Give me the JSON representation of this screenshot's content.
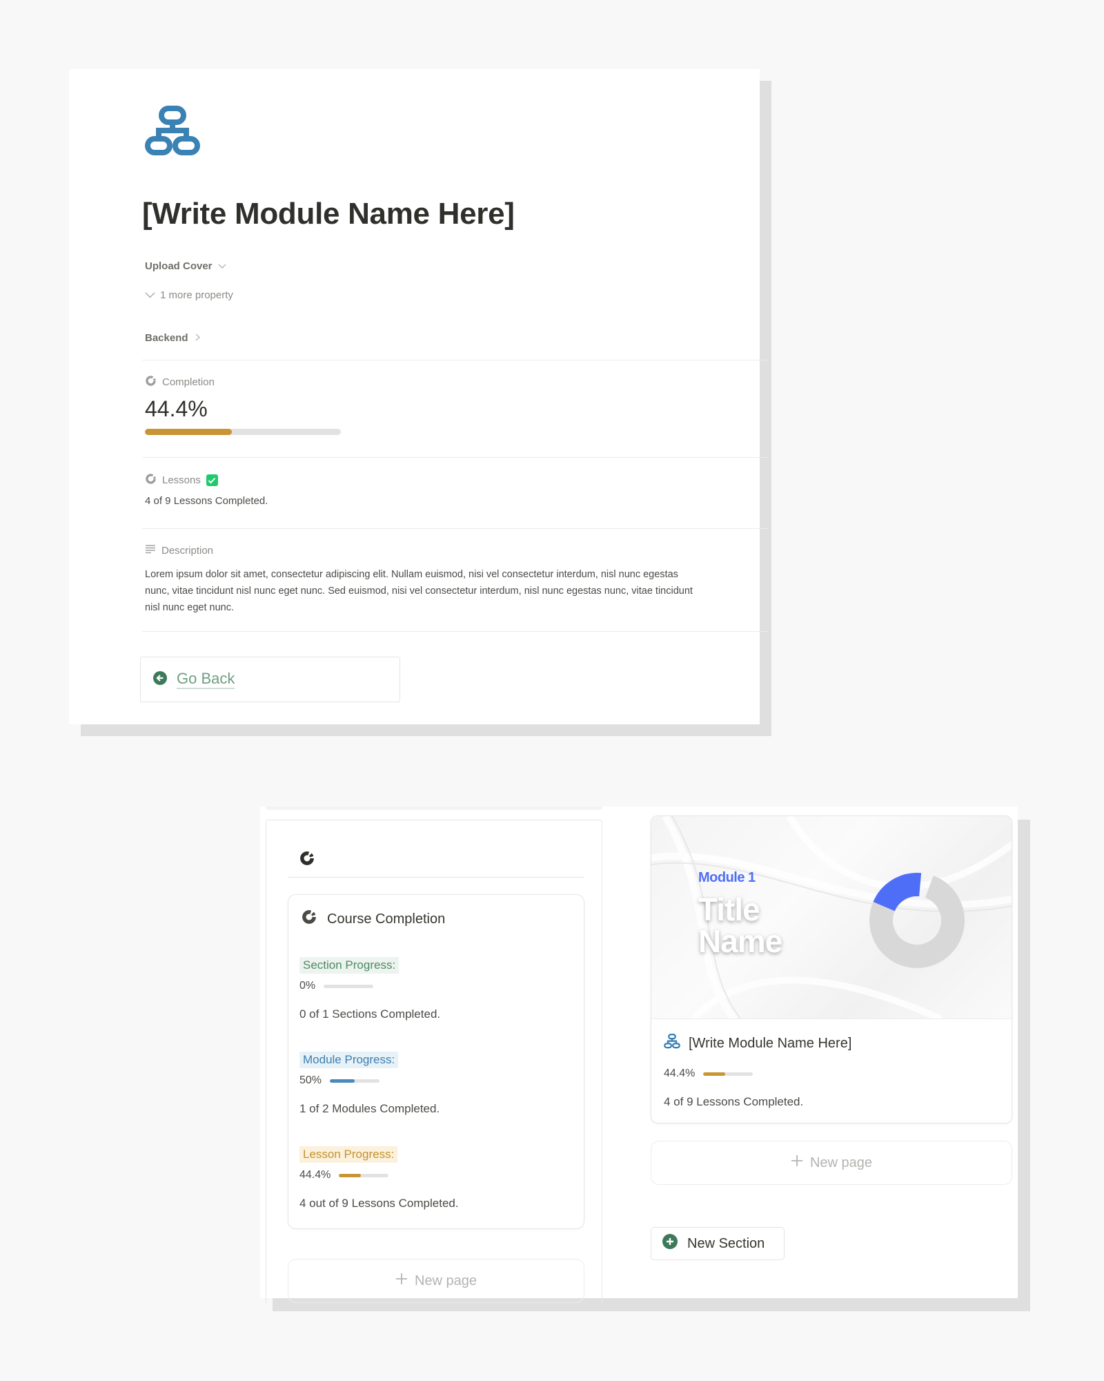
{
  "module_page": {
    "icon": "hierarchy-icon",
    "title": "[Write Module Name Here]",
    "upload_cover_label": "Upload Cover",
    "more_property_label": "1 more property",
    "backend_label": "Backend",
    "completion": {
      "label": "Completion",
      "icon": "progress-ring-icon",
      "value_text": "44.4%",
      "progress": 0.444,
      "color": "#c99433"
    },
    "lessons": {
      "label": "Lessons",
      "icon": "progress-ring-icon",
      "checked": true,
      "text": "4 of 9 Lessons Completed."
    },
    "description": {
      "label": "Description",
      "icon": "text-lines-icon",
      "text": "Lorem ipsum dolor sit amet, consectetur adipiscing elit. Nullam euismod, nisi vel consectetur interdum, nisl nunc egestas nunc, vitae tincidunt nisl nunc eget nunc. Sed euismod, nisi vel consectetur interdum, nisl nunc egestas nunc, vitae tincidunt nisl nunc eget nunc."
    },
    "go_back_label": "Go Back",
    "go_back_icon": "arrow-left-circle-icon"
  },
  "dashboard": {
    "column_icon": "progress-ring-icon",
    "course_completion": {
      "title": "Course Completion",
      "section": {
        "label": "Section Progress:",
        "value_text": "0%",
        "progress": 0,
        "count_text": "0 of 1 Sections Completed.",
        "color": "#4d8a62"
      },
      "module": {
        "label": "Module Progress:",
        "value_text": "50%",
        "progress": 0.5,
        "count_text": "1 of 2 Modules Completed.",
        "color": "#4a89b9"
      },
      "lesson": {
        "label": "Lesson Progress:",
        "value_text": "44.4%",
        "progress": 0.444,
        "count_text": "4 out of 9 Lessons Completed.",
        "color": "#c99433"
      }
    },
    "new_page_label": "New page",
    "module_card": {
      "cover_eyebrow": "Module 1",
      "cover_title_line1": "Title",
      "cover_title_line2": "Name",
      "cover_donut_progress": 0.2,
      "cover_donut_color": "#4f6ef7",
      "title": "[Write Module Name Here]",
      "value_text": "44.4%",
      "progress": 0.444,
      "count_text": "4 of 9 Lessons Completed."
    },
    "new_section_label": "New Section"
  }
}
